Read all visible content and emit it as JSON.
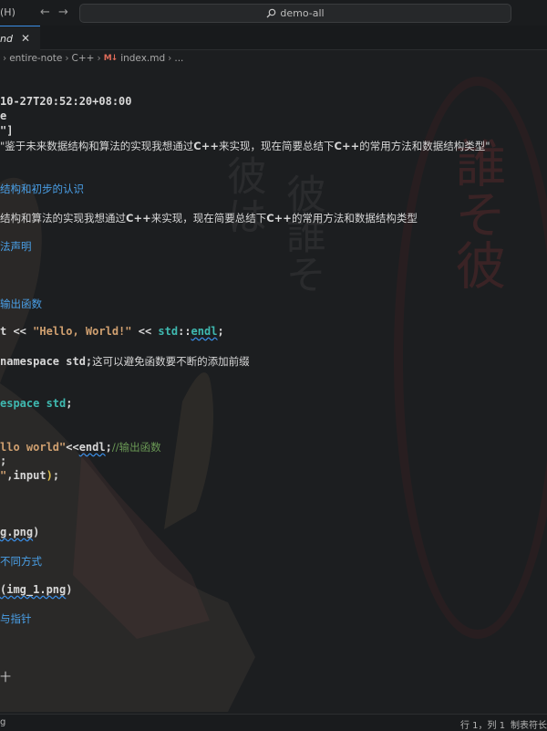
{
  "titlebar": {
    "menu_fragment": "(H)",
    "search_text": "demo-all",
    "icons": [
      "back-arrow-icon",
      "forward-arrow-icon",
      "search-icon"
    ]
  },
  "tab": {
    "name": "nd",
    "close_glyph": "✕"
  },
  "breadcrumb": {
    "items": [
      "entire-note",
      "C++",
      "index.md",
      "..."
    ],
    "file_icon_text": "M↓"
  },
  "editor": {
    "l1": "10-27T20:52:20+08:00",
    "l2": "e",
    "l3": "\"]",
    "l4a": "\"鉴于未来数据结构和算法的实现我想通过",
    "l4b": "C++",
    "l4c": "来实现，现在简要总结下",
    "l4d": "C++",
    "l4e": "的常用方法和数据结构类型\"",
    "h1": "结构和初步的认识",
    "l5a": "结构和算法的实现我想通过",
    "l5b": "C++",
    "l5c": "来实现，现在简要总结下",
    "l5d": "C++",
    "l5e": "的常用方法和数据结构类型",
    "h2": "法声明",
    "h3": "输出函数",
    "l6a": "t << ",
    "l6b": "\"Hello, World!\"",
    "l6c": " << ",
    "l6d": "std",
    "l6e": "::",
    "l6f": "endl",
    "l6g": ";",
    "l7a": "namespace std;",
    "l7b": "这可以避免函数要不断的添加前缀",
    "l8a": "espace ",
    "l8b": "std",
    "l8c": ";",
    "l9a": "llo world\"",
    "l9b": "<<",
    "l9c": "endl",
    "l9d": ";",
    "l9e": "//输出函数",
    "l10": ";",
    "l11a": "\"",
    "l11b": ",input",
    "l11c": ")",
    "l11d": ";",
    "l12a": "g.png",
    "l12b": ")",
    "h4": "不同方式",
    "l13a": "(img_1.png",
    "l13b": ")",
    "h5": "与指针",
    "l14": "十"
  },
  "statusbar": {
    "left": "g",
    "position": "行 1，列 1",
    "tab_size": "制表符长"
  },
  "background_text": {
    "col1": "彼は",
    "col2": "彼誰そ",
    "col3": "誰そ彼"
  },
  "colors": {
    "accent": "#3a8ee6",
    "heading": "#4aa0e8",
    "string": "#d0a070",
    "namespace": "#3fb9b0",
    "comment": "#6a9955"
  }
}
